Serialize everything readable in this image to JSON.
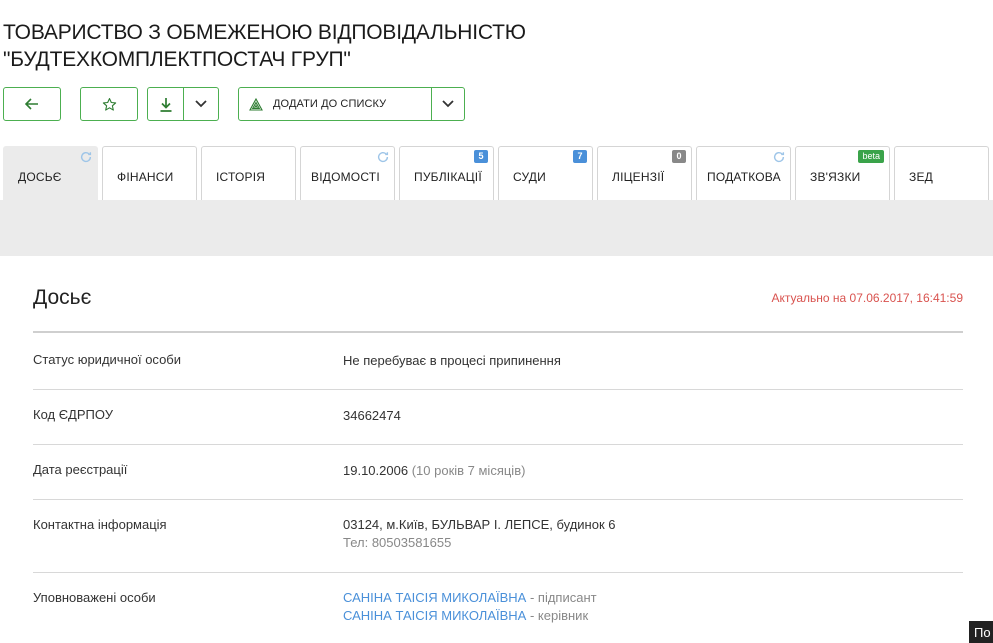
{
  "company": {
    "name_line1": "ТОВАРИСТВО З ОБМЕЖЕНОЮ ВІДПОВІДАЛЬНІСТЮ",
    "name_line2": "\"БУДТЕХКОМПЛЕКТПОСТАЧ ГРУП\""
  },
  "toolbar": {
    "add_to_list_label": "ДОДАТИ ДО СПИСКУ",
    "accent": "#4caf50"
  },
  "tabs": [
    {
      "label": "ДОСЬЄ",
      "active": true,
      "icon": "refresh-icon"
    },
    {
      "label": "ФІНАНСИ"
    },
    {
      "label": "ІСТОРІЯ"
    },
    {
      "label": "ВІДОМОСТІ",
      "icon": "refresh-icon"
    },
    {
      "label": "ПУБЛІКАЦІЇ",
      "badge": "5",
      "badge_color": "#4a90d9"
    },
    {
      "label": "СУДИ",
      "badge": "7",
      "badge_color": "#4a90d9"
    },
    {
      "label": "ЛІЦЕНЗІЇ",
      "badge": "0",
      "badge_color": "#888888"
    },
    {
      "label": "ПОДАТКОВА",
      "icon": "refresh-icon"
    },
    {
      "label": "ЗВ'ЯЗКИ",
      "badge": "beta",
      "badge_color": "#3aa34a"
    },
    {
      "label": "ЗЕД"
    }
  ],
  "dossier": {
    "title": "Досьє",
    "updated": "Актуально на 07.06.2017, 16:41:59",
    "rows": {
      "status": {
        "label": "Статус юридичної особи",
        "value": "Не перебуває в процесі припинення"
      },
      "edrpou": {
        "label": "Код ЄДРПОУ",
        "value": "34662474"
      },
      "registration": {
        "label": "Дата реєстрації",
        "date": "19.10.2006",
        "age": "(10 років 7 місяців)"
      },
      "contacts": {
        "label": "Контактна інформація",
        "address": "03124, м.Київ, БУЛЬВАР І. ЛЕПСЕ, будинок 6",
        "phone": "Тел: 80503581655"
      },
      "persons": {
        "label": "Уповноважені особи",
        "items": [
          {
            "name": "САНІНА ТАІСІЯ МИКОЛАЇВНА",
            "role": " - підписант"
          },
          {
            "name": "САНІНА ТАІСІЯ МИКОЛАЇВНА",
            "role": " - керівник"
          }
        ]
      }
    }
  },
  "corner_text": "По"
}
